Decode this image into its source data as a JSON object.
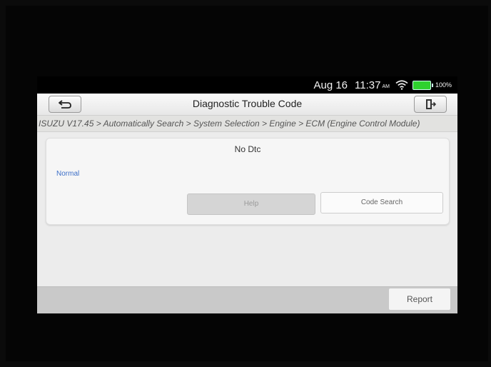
{
  "status_bar": {
    "date": "Aug 16",
    "time": "11:37",
    "ampm": "AM",
    "battery": "100%"
  },
  "header": {
    "title": "Diagnostic Trouble Code",
    "back_icon": "back-arrow-icon",
    "exit_icon": "exit-door-icon"
  },
  "breadcrumb": "ISUZU V17.45 > Automatically Search > System Selection > Engine > ECM (Engine Control Module)",
  "dtc": {
    "title": "No Dtc",
    "status": "Normal",
    "help_label": "Help",
    "code_search_label": "Code Search"
  },
  "footer": {
    "report_label": "Report"
  },
  "colors": {
    "status_text": "#3d6fc8",
    "battery": "#2ed12e"
  }
}
